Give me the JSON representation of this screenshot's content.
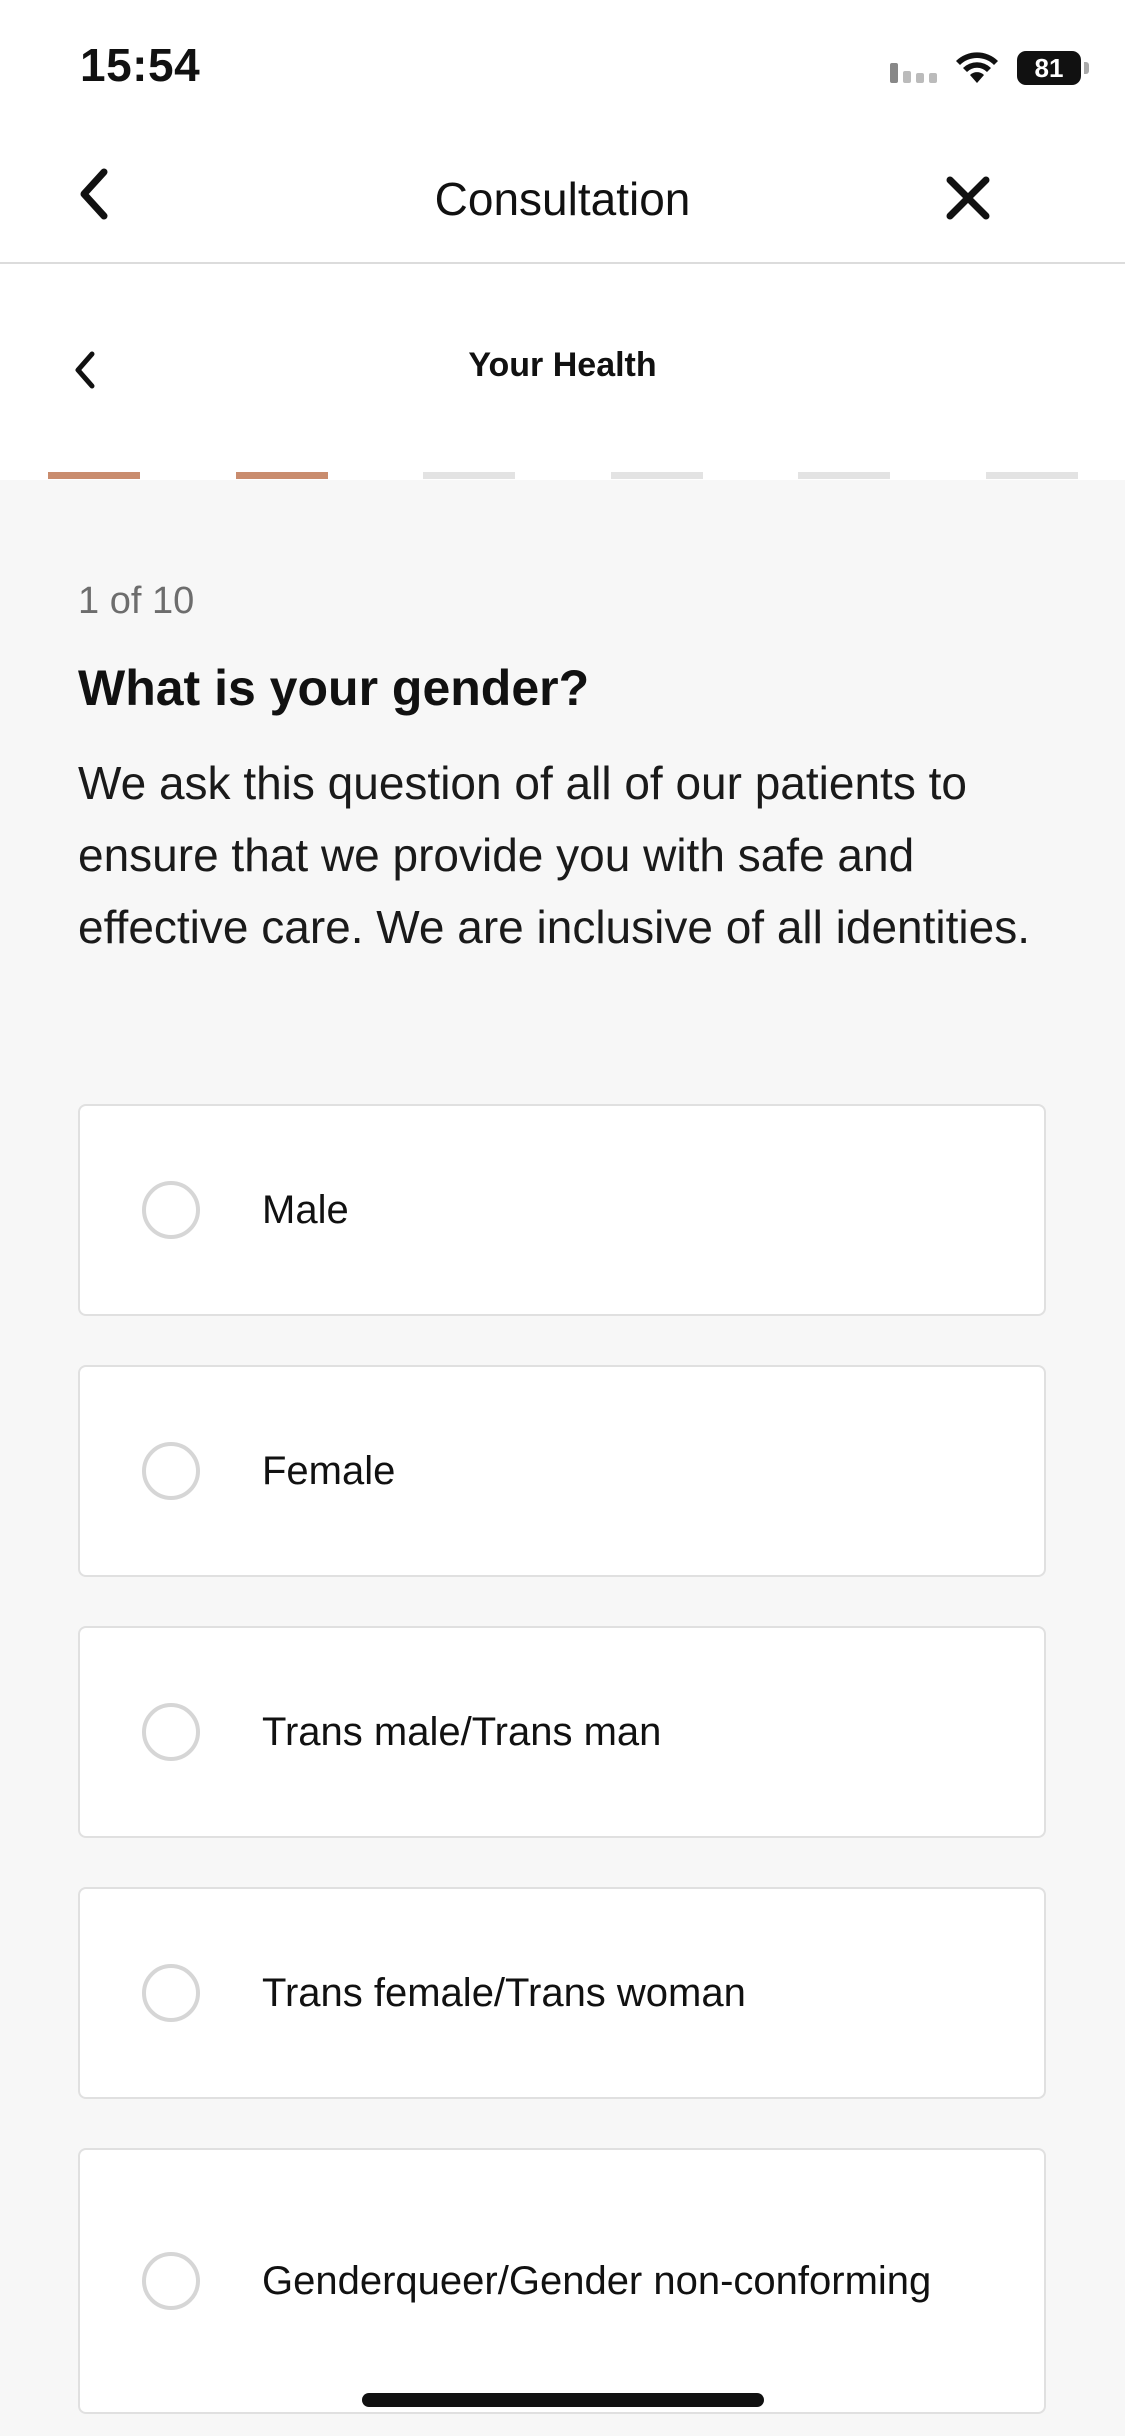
{
  "status": {
    "time": "15:54",
    "battery": "81"
  },
  "nav": {
    "title": "Consultation"
  },
  "section": {
    "title": "Your Health"
  },
  "progress": {
    "total_segments": 6,
    "completed_segments": 2
  },
  "question": {
    "step": "1 of 10",
    "title": "What is your gender?",
    "description": "We ask this question of all of our patients to ensure that we provide you with safe and effective care. We are inclusive of all identities."
  },
  "options": [
    {
      "label": "Male",
      "selected": false
    },
    {
      "label": "Female",
      "selected": false
    },
    {
      "label": "Trans male/Trans man",
      "selected": false
    },
    {
      "label": "Trans female/Trans woman",
      "selected": false
    },
    {
      "label": "Genderqueer/Gender non-conforming",
      "selected": false
    }
  ],
  "colors": {
    "accent": "#c98c6e",
    "background": "#f7f7f7"
  }
}
